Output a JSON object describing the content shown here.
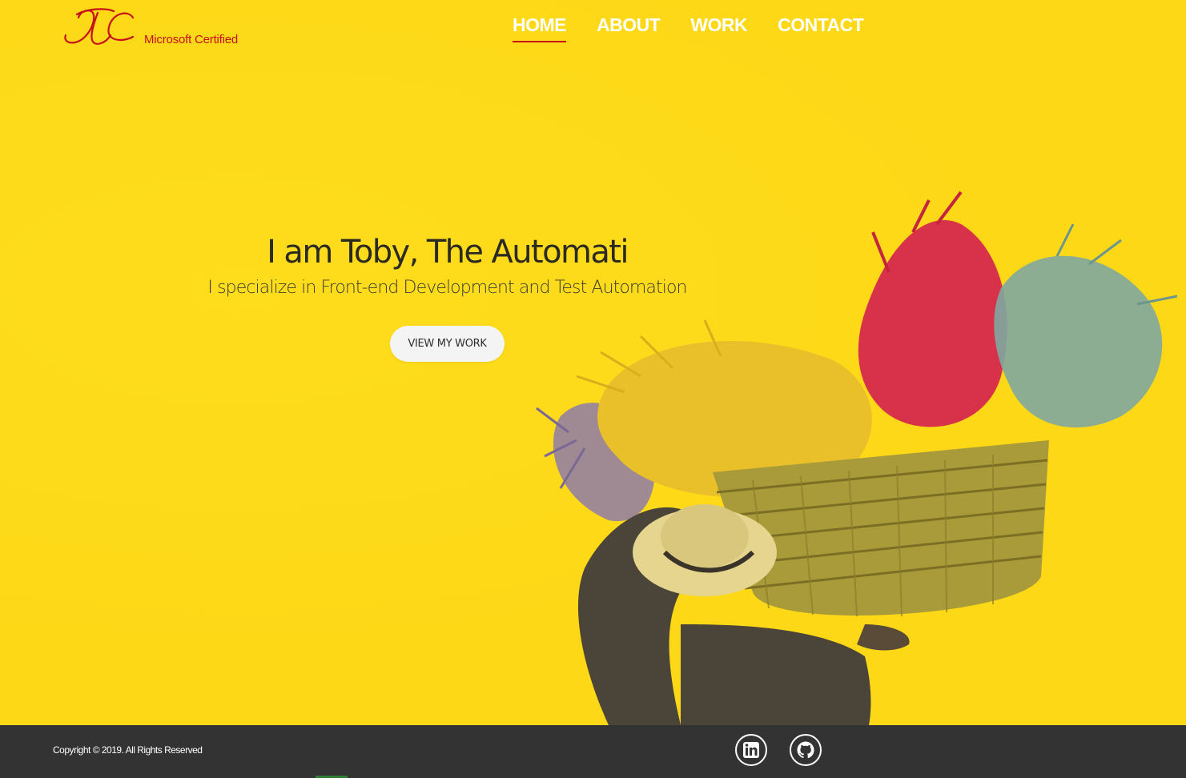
{
  "header": {
    "logo_text": "Microsoft Certified",
    "nav": [
      {
        "label": "HOME",
        "active": true
      },
      {
        "label": "ABOUT",
        "active": false
      },
      {
        "label": "WORK",
        "active": false
      },
      {
        "label": "CONTACT",
        "active": false
      }
    ]
  },
  "hero": {
    "headline": "I am Toby, The Automati",
    "subheadline": "I specialize in Front-end Development and Test Automation",
    "cta_label": "VIEW MY WORK"
  },
  "footer": {
    "copyright": "Copyright © 2019. All Rights Reserved",
    "social": [
      {
        "icon": "linkedin-icon"
      },
      {
        "icon": "github-icon"
      }
    ]
  },
  "colors": {
    "background": "#FDD817",
    "accent": "#C6101A",
    "footer": "#333333",
    "nav_text": "#FFFFFF"
  }
}
